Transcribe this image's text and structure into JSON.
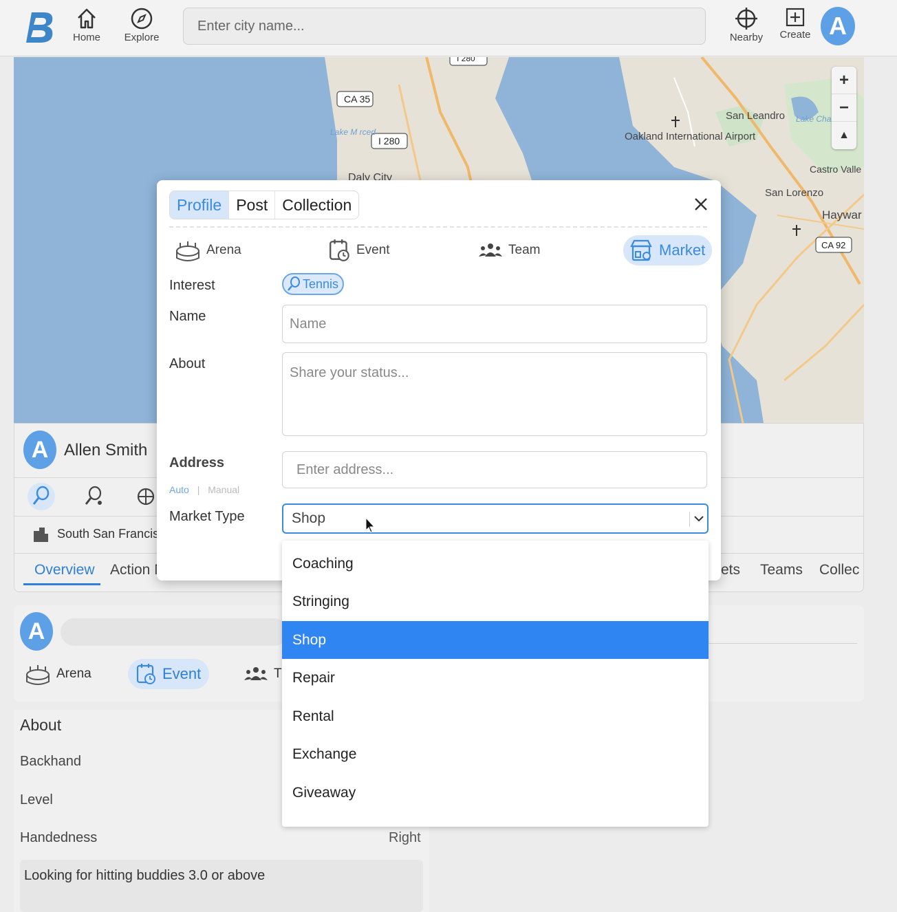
{
  "nav": {
    "home": "Home",
    "explore": "Explore",
    "search_placeholder": "Enter city name...",
    "nearby": "Nearby",
    "create": "Create",
    "avatar_letter": "A"
  },
  "map": {
    "labels": {
      "ca35": "CA 35",
      "i280": "I 280",
      "i280_top": "I 280",
      "daly_city": "Daly City",
      "san_leandro": "San Leandro",
      "oakland_airport": "Oakland International Airport",
      "castro_valley": "Castro Valle",
      "san_lorenzo": "San Lorenzo",
      "hayward": "Haywar",
      "ca92": "CA 92",
      "lake_chabot": "Lake Chabot",
      "lake_merced": "Lake M rced"
    },
    "zoom_in": "+",
    "zoom_out": "−",
    "compass": "▲"
  },
  "profile": {
    "avatar_letter": "A",
    "name": "Allen Smith",
    "location": "South San Francis",
    "tabs": [
      "Overview",
      "Action N"
    ],
    "right_tabs": [
      "ets",
      "Teams",
      "Collec"
    ]
  },
  "composer": {
    "avatar_letter": "A",
    "items": [
      "Arena",
      "Event",
      "T"
    ]
  },
  "about": {
    "title": "About",
    "rows": [
      {
        "label": "Backhand",
        "value": ""
      },
      {
        "label": "Level",
        "value": ""
      },
      {
        "label": "Handedness",
        "value": "Right"
      }
    ],
    "note": "Looking for hitting buddies 3.0 or above"
  },
  "modal": {
    "tabs": [
      "Profile",
      "Post",
      "Collection"
    ],
    "active_tab": "Profile",
    "categories": [
      "Arena",
      "Event",
      "Team",
      "Market"
    ],
    "active_category": "Market",
    "interest_label": "Interest",
    "interest_chip": "Tennis",
    "name_label": "Name",
    "name_placeholder": "Name",
    "about_label": "About",
    "about_placeholder": "Share your status...",
    "address_label": "Address",
    "address_placeholder": "Enter address...",
    "address_mode_auto": "Auto",
    "address_mode_sep": "|",
    "address_mode_manual": "Manual",
    "market_type_label": "Market Type",
    "market_type_value": "Shop",
    "market_type_options": [
      "Coaching",
      "Stringing",
      "Shop",
      "Repair",
      "Rental",
      "Exchange",
      "Giveaway"
    ]
  },
  "colors": {
    "accent": "#2f86f3",
    "chip_bg": "#d7e6f8",
    "map_water": "#8fb4d8",
    "map_land": "#e8e4dc"
  }
}
